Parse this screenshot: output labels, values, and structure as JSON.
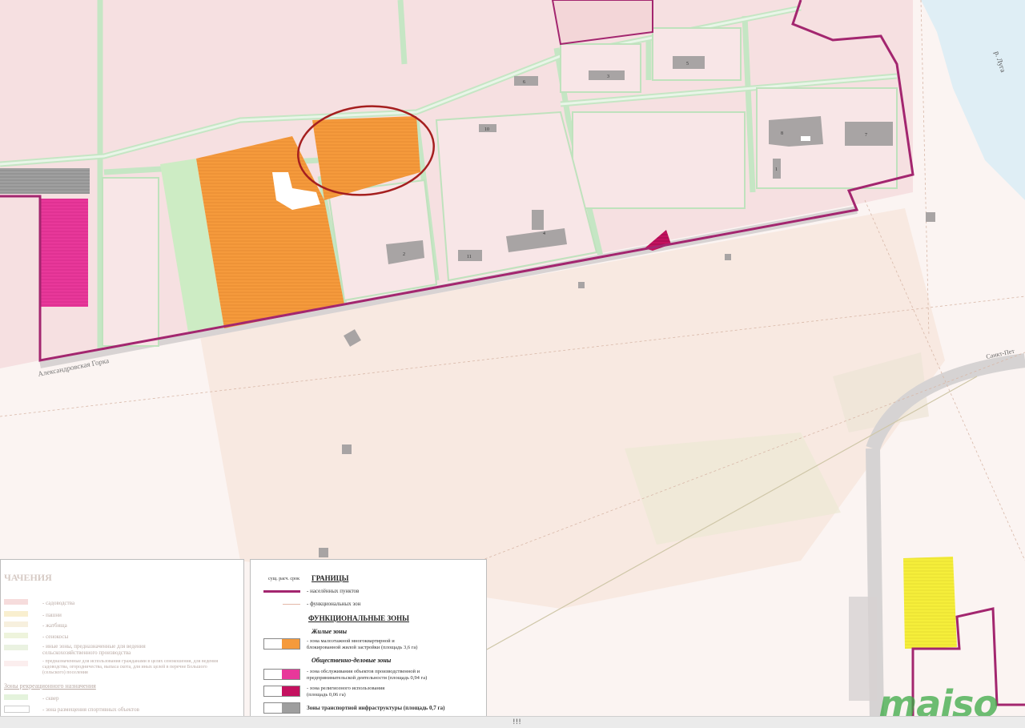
{
  "map": {
    "street_label": "Александровская Горка",
    "river_label": "р. Луга",
    "road_label_east": "Санкт-Пет",
    "building_numbers": [
      "6",
      "3",
      "5",
      "10",
      "8",
      "7",
      "1",
      "4",
      "2",
      "11"
    ]
  },
  "legend_left": {
    "title": "ЧАЧЕНИЯ",
    "items": [
      "- садоводства",
      "- пашни",
      "- жатбища",
      "- сенокосы",
      "- иные зоны, предназначенные для ведения сельскохозяйственного производства",
      "- предназначенные для использования гражданами в целях сенокошения, для ведения садоводства, огородничества, выпаса скота, для иных целей в перечне Большого (сельского) поселения"
    ],
    "section": "Зоны рекреационного назначения",
    "section_items": [
      "- сквер",
      "- зона размещения спортивных объектов"
    ]
  },
  "legend_right": {
    "col_labels": "сущ.   расч. срок",
    "boundaries_heading": "ГРАНИЦЫ",
    "boundary_settlements": "- населённых пунктов",
    "boundary_zones": "- функциональных зон",
    "zones_heading": "ФУНКЦИОНАЛЬНЫЕ ЗОНЫ",
    "residential_heading": "Жилые зоны",
    "residential_item_1": "- зона малоэтажной многоквартирной и",
    "residential_item_2": "блокированной жилой застройки (площадь 3,6 га)",
    "business_heading": "Общественно-деловые зоны",
    "business_item_1a": "- зона обслуживания объектов производственной и",
    "business_item_1b": "предпринимательской деятельности (площадь 0,94 га)",
    "business_item_2a": "- зона религиозного использования",
    "business_item_2b": "(площадь 0,06 га)",
    "transport_item": "Зоны транспортной инфраструктуры (площадь 0,7 га)"
  },
  "colors": {
    "boundary": "#a3266f",
    "residential_new": "#f59a3c",
    "service_zone": "#e8389a",
    "religious_zone": "#c4115f",
    "transport": "#9e9e9e",
    "recreation": "#cdecc4",
    "road": "#d7ecd5",
    "water": "#dfeef5",
    "yellow_zone": "#f5ee3a",
    "highlight_circle": "#a51f1f"
  },
  "watermark": "maiso",
  "scroll_indicator": "!!!"
}
